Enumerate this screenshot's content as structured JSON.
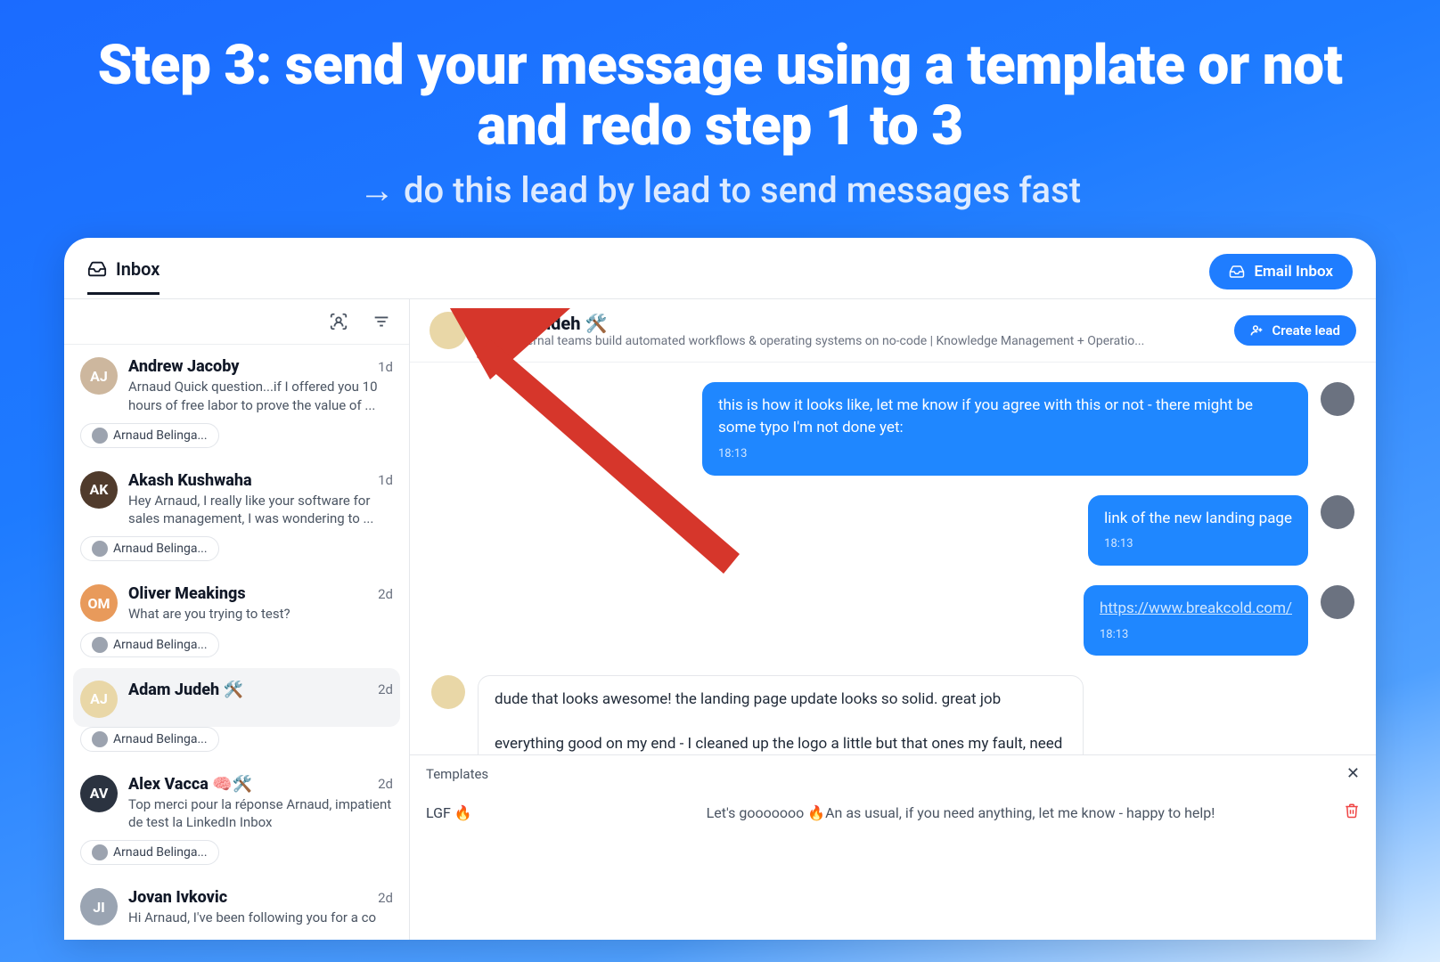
{
  "hero": {
    "title": "Step 3: send your message using a template or not and redo step 1 to 3",
    "subtitle_arrow": "→",
    "subtitle": "do this lead by lead to send messages fast"
  },
  "topbar": {
    "tab_label": "Inbox",
    "email_button": "Email Inbox"
  },
  "sidebar_tag": "Arnaud Belinga...",
  "threads": [
    {
      "name": "Andrew Jacoby",
      "time": "1d",
      "preview": "Arnaud Quick question...if I offered you 10 hours of free labor to prove the value of ...",
      "active": false,
      "av_bg": "#cdb79e",
      "av_init": "AJ",
      "show_tag": true
    },
    {
      "name": "Akash Kushwaha",
      "time": "1d",
      "preview": "Hey Arnaud, I really like your software for sales management, I was wondering to ...",
      "active": false,
      "av_bg": "#503b2c",
      "av_init": "AK",
      "show_tag": true
    },
    {
      "name": "Oliver Meakings",
      "time": "2d",
      "preview": "What are you trying to test?",
      "active": false,
      "av_bg": "#e89a5b",
      "av_init": "OM",
      "show_tag": true
    },
    {
      "name": "Adam Judeh 🛠️",
      "time": "2d",
      "preview": "",
      "active": true,
      "av_bg": "#e9d7a7",
      "av_init": "AJ",
      "show_tag": true
    },
    {
      "name": "Alex Vacca 🧠🛠️",
      "time": "2d",
      "preview": "Top merci pour la réponse Arnaud, impatient de test la LinkedIn Inbox",
      "active": false,
      "av_bg": "#2b3340",
      "av_init": "AV",
      "show_tag": true
    },
    {
      "name": "Jovan Ivkovic",
      "time": "2d",
      "preview": "Hi Arnaud, I've been following you for a co",
      "active": false,
      "av_bg": "#9aa4b2",
      "av_init": "JI",
      "show_tag": false
    }
  ],
  "chat": {
    "name": "Adam Judeh 🛠️",
    "sub": "I help internal teams build automated workflows & operating systems on no-code | Knowledge Management + Operatio...",
    "create_lead": "Create lead",
    "messages": [
      {
        "side": "right",
        "text": "this is how it looks like, let me know if you agree with this or not - there might be some typo I'm not done yet:",
        "time": "18:13"
      },
      {
        "side": "right",
        "text": "link of the new landing page",
        "time": "18:13"
      },
      {
        "side": "right",
        "text": "https://www.breakcold.com/",
        "time": "18:13",
        "is_link": true
      },
      {
        "side": "left",
        "text": "dude that looks awesome! the landing page update looks so solid. great job\n\neverything good on my end - I cleaned up the logo a little but that ones my fault, need to update the LI page 😬",
        "time": ""
      }
    ]
  },
  "templates": {
    "header": "Templates",
    "rows": [
      {
        "name": "LGF 🔥",
        "body": "Let's gooooooo 🔥An as usual, if you need anything, let me know - happy to help!"
      }
    ]
  }
}
